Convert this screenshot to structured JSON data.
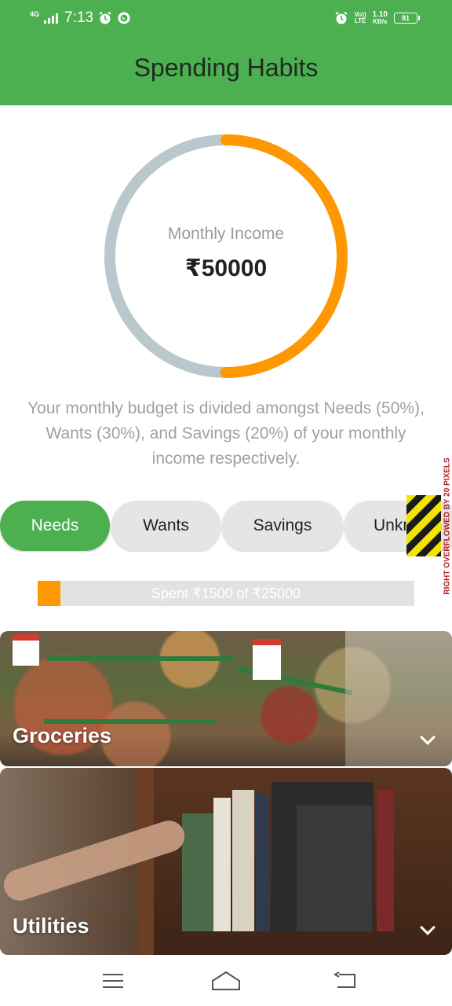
{
  "status_bar": {
    "network_type": "4G",
    "time": "7:13",
    "volte_line1": "Vo))",
    "volte_line2": "LTE",
    "speed_value": "1.10",
    "speed_unit": "KB/s",
    "battery_level": "81"
  },
  "app_bar": {
    "title": "Spending Habits"
  },
  "income": {
    "label": "Monthly Income",
    "value": "₹50000",
    "ring": {
      "spent_fraction": 0.5,
      "spent_color": "#ff9800",
      "remaining_color": "#b9c8cd"
    }
  },
  "description": "Your monthly budget is divided amongst Needs (50%), Wants (30%), and Savings (20%) of your monthly income respectively.",
  "tabs": [
    {
      "label": "Needs",
      "active": true
    },
    {
      "label": "Wants",
      "active": false
    },
    {
      "label": "Savings",
      "active": false
    },
    {
      "label": "Unknown",
      "active": false
    }
  ],
  "overflow_warning": "RIGHT OVERFLOWED BY 20 PIXELS",
  "progress": {
    "text": "Spent ₹1500 of ₹25000",
    "fraction": 0.06
  },
  "categories": [
    {
      "title": "Groceries",
      "expand_icon": "chevron-down-icon"
    },
    {
      "title": "Utilities",
      "expand_icon": "chevron-down-icon"
    }
  ],
  "colors": {
    "accent": "#4caf50",
    "orange": "#ff9800",
    "muted_text": "#a0a0a0"
  },
  "nav_bar": {
    "icons": [
      "menu-icon",
      "home-icon",
      "back-icon"
    ]
  }
}
